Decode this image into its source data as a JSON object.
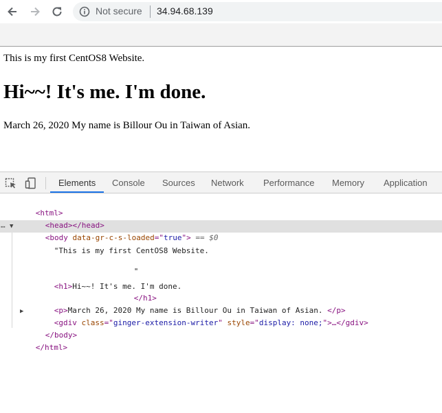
{
  "browser": {
    "security_label": "Not secure",
    "url": "34.94.68.139",
    "icons": [
      "back-arrow-icon",
      "forward-arrow-icon",
      "reload-icon",
      "info-icon"
    ]
  },
  "page": {
    "intro_text": "This is my first CentOS8 Website.",
    "heading": "Hi~~! It's me. I'm done.",
    "paragraph": "March 26, 2020 My name is Billour Ou in Taiwan of Asian."
  },
  "devtools": {
    "icons": [
      "inspect-element-icon",
      "device-toolbar-icon"
    ],
    "tabs": [
      {
        "label": "Elements",
        "active": true
      },
      {
        "label": "Console"
      },
      {
        "label": "Sources"
      },
      {
        "label": "Network"
      },
      {
        "label": "Performance"
      },
      {
        "label": "Memory"
      },
      {
        "label": "Application"
      }
    ],
    "dom": {
      "html_open": "<html>",
      "head": "<head></head>",
      "body_open_tag": "<body ",
      "body_attr_name": "data-gr-c-s-loaded",
      "body_attr_eq": "=\"",
      "body_attr_value": "true",
      "body_attr_close": "\">",
      "body_selected_marker": " == $0",
      "text_node": "\"This is my first CentOS8 Website.",
      "text_node_end": "\"",
      "h1_open": "<h1>",
      "h1_text": "Hi~~! It's me. I'm done.",
      "h1_close": "</h1>",
      "p_open": "<p>",
      "p_text": "March 26, 2020 My name is Billour Ou in Taiwan of Asian. ",
      "p_close": "</p>",
      "gdiv_open": "<gdiv ",
      "gdiv_class_name": "class",
      "gdiv_class_value": "ginger-extension-writer",
      "gdiv_style_name": "style",
      "gdiv_style_value": "display: none;",
      "gdiv_tail": ">…</gdiv>",
      "body_close": "</body>",
      "html_close": "</html>"
    }
  }
}
